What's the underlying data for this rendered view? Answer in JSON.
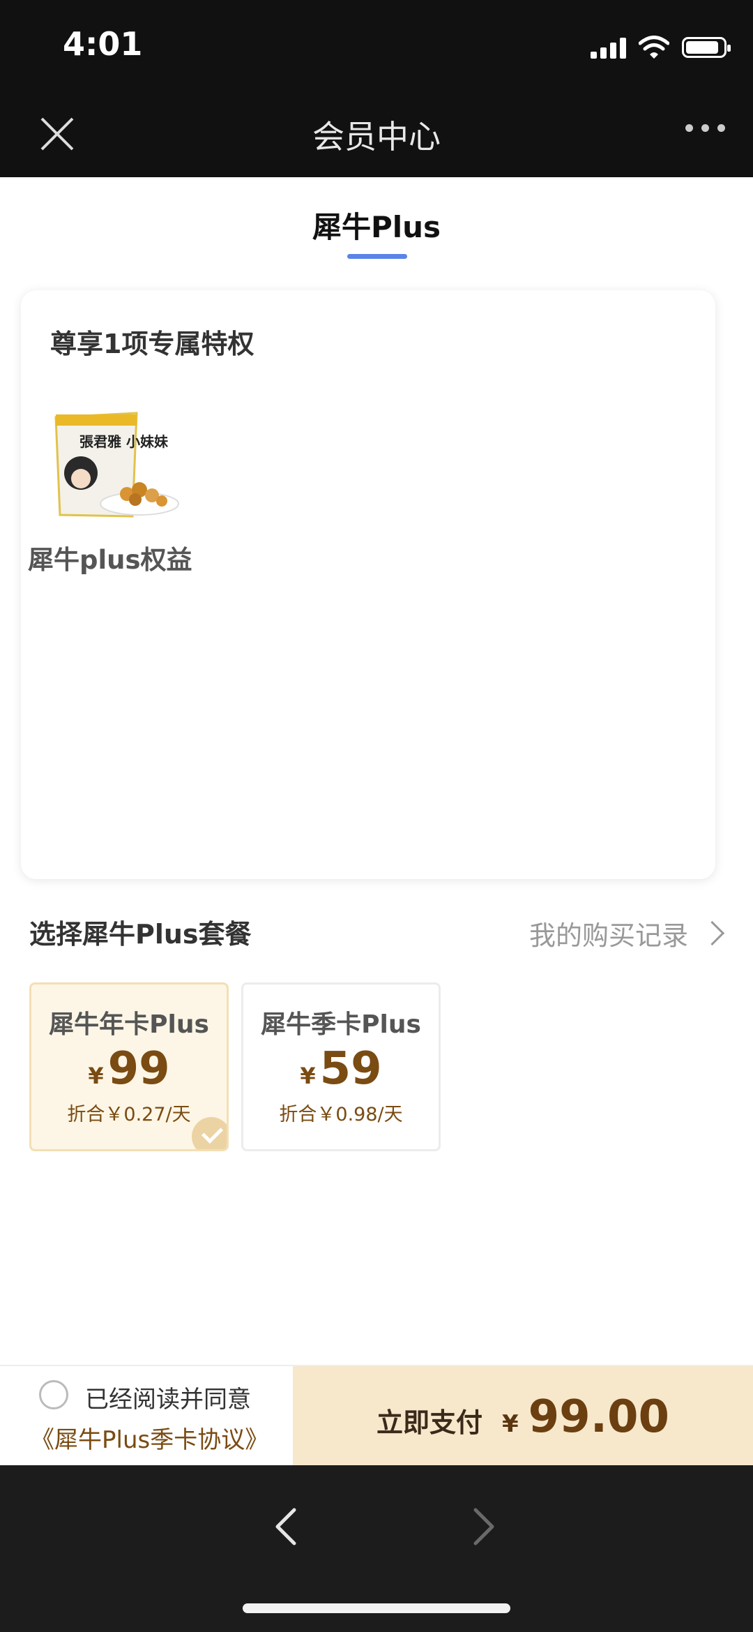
{
  "status_bar": {
    "time": "4:01"
  },
  "nav": {
    "title": "会员中心"
  },
  "tab": {
    "label": "犀牛Plus"
  },
  "privileges": {
    "title": "尊享1项专属特权",
    "items": [
      {
        "label": "犀牛plus权益",
        "image_text": "張君雅 小妹妹"
      }
    ]
  },
  "plans": {
    "section_title": "选择犀牛Plus套餐",
    "history_link": "我的购买记录",
    "items": [
      {
        "name": "犀牛年卡Plus",
        "currency": "¥",
        "price": "99",
        "daily": "折合￥0.27/天",
        "selected": true
      },
      {
        "name": "犀牛季卡Plus",
        "currency": "¥",
        "price": "59",
        "daily": "折合￥0.98/天",
        "selected": false
      }
    ]
  },
  "pay_bar": {
    "agree_text": "已经阅读并同意",
    "agreement_link": "《犀牛Plus季卡协议》",
    "pay_label": "立即支付",
    "currency": "¥",
    "amount": "99.00"
  },
  "colors": {
    "accent_tab": "#5b84e8",
    "gold_text": "#7a4b12",
    "pay_bg": "#f7e8cc"
  }
}
